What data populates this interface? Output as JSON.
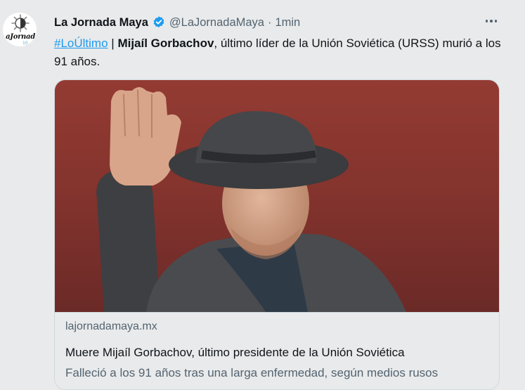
{
  "account": {
    "name": "La Jornada Maya",
    "handle": "@LaJornadaMaya",
    "separator": "·",
    "time": "1min",
    "avatar_brand": "aJornad",
    "avatar_sub": "10"
  },
  "tweet": {
    "hashtag": "#LoÚltimo",
    "pipe": "|",
    "bold_name": "Mijaíl Gorbachov",
    "text_rest": ", último líder de la Unión Soviética (URSS) murió a los 91 años."
  },
  "card": {
    "domain": "lajornadamaya.mx",
    "title": "Muere Mijaíl Gorbachov, último presidente de la Unión Soviética",
    "description": "Falleció a los 91 años tras una larga enfermedad, según medios rusos"
  },
  "colors": {
    "accent": "#1d9bf0",
    "background": "#e9eaeb",
    "secondary_text": "#536471",
    "border": "#cfd9de"
  },
  "icons": {
    "verified": "verified-badge-icon",
    "more": "more-options-icon"
  }
}
